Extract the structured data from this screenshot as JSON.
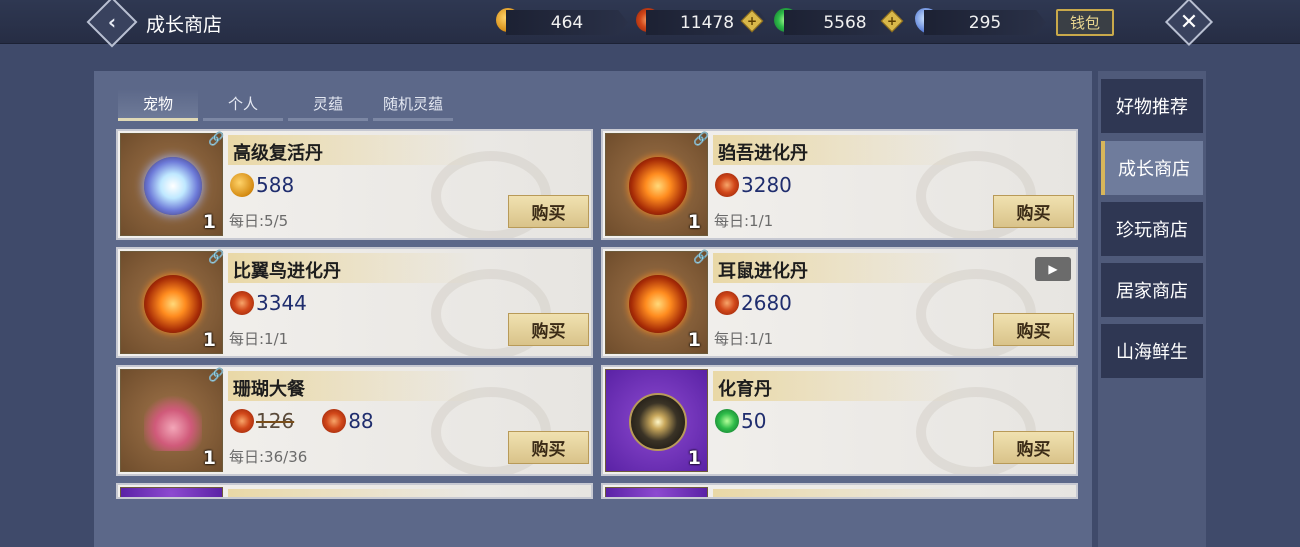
{
  "header": {
    "title": "成长商店",
    "wallet_label": "钱包"
  },
  "currencies": [
    {
      "icon": "gold-coin-icon",
      "value": "464"
    },
    {
      "icon": "red-swirl-coin-icon",
      "value": "11478"
    },
    {
      "icon": "jade-coin-icon",
      "value": "5568"
    },
    {
      "icon": "blue-crystal-icon",
      "value": "295"
    }
  ],
  "tabs": [
    {
      "label": "宠物",
      "active": true
    },
    {
      "label": "个人"
    },
    {
      "label": "灵蕴"
    },
    {
      "label": "随机灵蕴"
    }
  ],
  "items": [
    {
      "name": "高级复活丹",
      "price": "588",
      "currency": "gold",
      "daily": "每日:5/5",
      "qty": "1",
      "thumb": "crystal"
    },
    {
      "name": "驺吾进化丹",
      "price": "3280",
      "currency": "red",
      "daily": "每日:1/1",
      "qty": "1",
      "thumb": "fire"
    },
    {
      "name": "比翼鸟进化丹",
      "price": "3344",
      "currency": "red",
      "daily": "每日:1/1",
      "qty": "1",
      "thumb": "fire"
    },
    {
      "name": "耳鼠进化丹",
      "price": "2680",
      "currency": "red",
      "daily": "每日:1/1",
      "qty": "1",
      "thumb": "fire",
      "video": true
    },
    {
      "name": "珊瑚大餐",
      "old_price": "126",
      "price": "88",
      "currency": "red",
      "daily": "每日:36/36",
      "qty": "1",
      "thumb": "coral"
    },
    {
      "name": "化育丹",
      "price": "50",
      "currency": "green",
      "daily": "",
      "qty": "1",
      "thumb": "dark"
    }
  ],
  "buy_label": "购买",
  "sidebar": [
    {
      "label": "好物推荐"
    },
    {
      "label": "成长商店",
      "active": true
    },
    {
      "label": "珍玩商店"
    },
    {
      "label": "居家商店"
    },
    {
      "label": "山海鲜生"
    }
  ]
}
